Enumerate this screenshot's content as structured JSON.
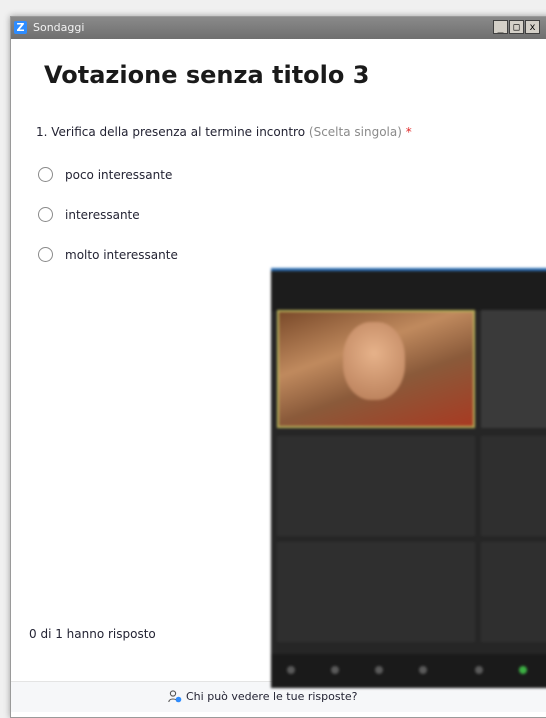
{
  "window": {
    "logo_letter": "Z",
    "title": "Sondaggi",
    "controls": {
      "minimize": "_",
      "maximize": "□",
      "close": "x"
    }
  },
  "poll": {
    "title": "Votazione senza titolo 3",
    "question": {
      "number_text": "1. Verifica della presenza al termine incontro",
      "hint": "(Scelta singola)",
      "required_mark": "*"
    },
    "options": [
      {
        "label": "poco interessante"
      },
      {
        "label": "interessante"
      },
      {
        "label": "molto interessante"
      }
    ],
    "responses": "0 di 1 hanno risposto"
  },
  "footer": {
    "visibility_link": "Chi può vedere le tue risposte?"
  },
  "colors": {
    "accent": "#2d8cff",
    "required": "#e02828",
    "active_speaker_border": "#b9b25a"
  }
}
